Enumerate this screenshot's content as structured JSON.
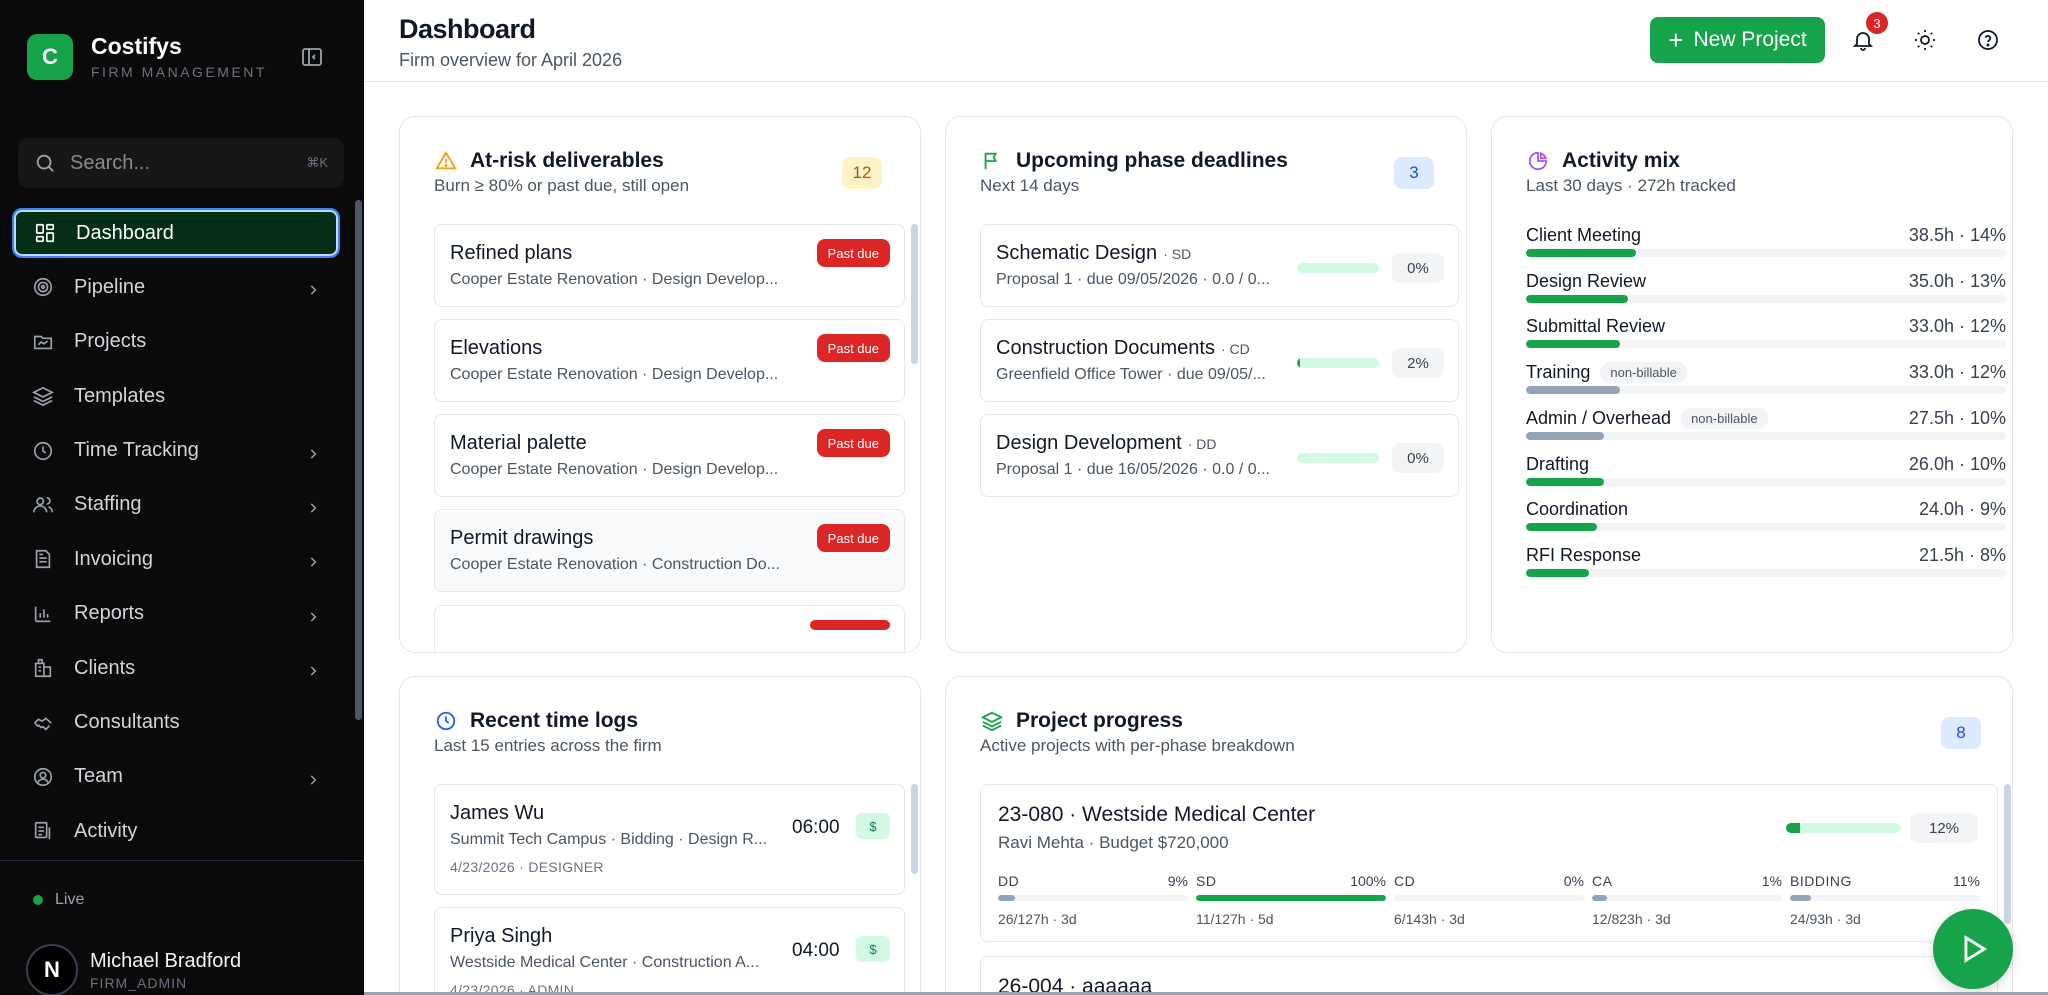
{
  "brand": {
    "initial": "C",
    "name": "Costifys",
    "subtitle": "FIRM MANAGEMENT"
  },
  "search": {
    "placeholder": "Search...",
    "shortcut": "⌘K"
  },
  "nav": [
    {
      "label": "Dashboard",
      "icon": "dashboard-icon",
      "active": true,
      "chevron": false
    },
    {
      "label": "Pipeline",
      "icon": "target-icon",
      "chevron": true
    },
    {
      "label": "Projects",
      "icon": "folder-icon",
      "chevron": false
    },
    {
      "label": "Templates",
      "icon": "layers-icon",
      "chevron": false
    },
    {
      "label": "Time Tracking",
      "icon": "clock-icon",
      "chevron": true
    },
    {
      "label": "Staffing",
      "icon": "users-icon",
      "chevron": true
    },
    {
      "label": "Invoicing",
      "icon": "invoice-icon",
      "chevron": true
    },
    {
      "label": "Reports",
      "icon": "bar-chart-icon",
      "chevron": true
    },
    {
      "label": "Clients",
      "icon": "building-icon",
      "chevron": true
    },
    {
      "label": "Consultants",
      "icon": "handshake-icon",
      "chevron": false
    },
    {
      "label": "Team",
      "icon": "user-circle-icon",
      "chevron": true
    },
    {
      "label": "Activity",
      "icon": "activity-icon",
      "chevron": false
    }
  ],
  "status": {
    "live_label": "Live"
  },
  "user": {
    "initial": "N",
    "name": "Michael Bradford",
    "role": "FIRM_ADMIN"
  },
  "header": {
    "title": "Dashboard",
    "subtitle": "Firm overview for April 2026",
    "new_project_label": "New Project",
    "notification_count": "3"
  },
  "at_risk": {
    "title": "At-risk deliverables",
    "subtitle": "Burn ≥ 80% or past due, still open",
    "count": "12",
    "items": [
      {
        "title": "Refined plans",
        "sub": "Cooper Estate Renovation · Design Develop...",
        "badge": "Past due"
      },
      {
        "title": "Elevations",
        "sub": "Cooper Estate Renovation · Design Develop...",
        "badge": "Past due"
      },
      {
        "title": "Material palette",
        "sub": "Cooper Estate Renovation · Design Develop...",
        "badge": "Past due"
      },
      {
        "title": "Permit drawings",
        "sub": "Cooper Estate Renovation · Construction Do...",
        "badge": "Past due"
      }
    ]
  },
  "deadlines": {
    "title": "Upcoming phase deadlines",
    "subtitle": "Next 14 days",
    "count": "3",
    "items": [
      {
        "title": "Schematic Design",
        "tag": "· SD",
        "sub": "Proposal 1 · due 09/05/2026 · 0.0 / 0...",
        "pct": "0%",
        "progress": 0
      },
      {
        "title": "Construction Documents",
        "tag": "· CD",
        "sub": "Greenfield Office Tower · due 09/05/...",
        "pct": "2%",
        "progress": 2
      },
      {
        "title": "Design Development",
        "tag": "· DD",
        "sub": "Proposal 1 · due 16/05/2026 · 0.0 / 0...",
        "pct": "0%",
        "progress": 0
      }
    ]
  },
  "activity_mix": {
    "title": "Activity mix",
    "subtitle": "Last 30 days · 272h tracked",
    "items": [
      {
        "name": "Client Meeting",
        "value": "38.5h · 14%",
        "pct": 14,
        "billable": true
      },
      {
        "name": "Design Review",
        "value": "35.0h · 13%",
        "pct": 13,
        "billable": true
      },
      {
        "name": "Submittal Review",
        "value": "33.0h · 12%",
        "pct": 12,
        "billable": true
      },
      {
        "name": "Training",
        "value": "33.0h · 12%",
        "pct": 12,
        "billable": false,
        "tag": "non-billable"
      },
      {
        "name": "Admin / Overhead",
        "value": "27.5h · 10%",
        "pct": 10,
        "billable": false,
        "tag": "non-billable"
      },
      {
        "name": "Drafting",
        "value": "26.0h · 10%",
        "pct": 10,
        "billable": true
      },
      {
        "name": "Coordination",
        "value": "24.0h · 9%",
        "pct": 9,
        "billable": true
      },
      {
        "name": "RFI Response",
        "value": "21.5h · 8%",
        "pct": 8,
        "billable": true
      }
    ],
    "colors": {
      "billable": "#16a34a",
      "non_billable": "#94a3b8"
    }
  },
  "time_logs": {
    "title": "Recent time logs",
    "subtitle": "Last 15 entries across the firm",
    "items": [
      {
        "name": "James Wu",
        "sub": "Summit Tech Campus · Bidding · Design R...",
        "meta": "4/23/2026 · DESIGNER",
        "time": "06:00",
        "money": "$"
      },
      {
        "name": "Priya Singh",
        "sub": "Westside Medical Center · Construction A...",
        "meta": "4/23/2026 · ADMIN",
        "time": "04:00",
        "money": "$"
      }
    ]
  },
  "project_progress": {
    "title": "Project progress",
    "subtitle": "Active projects with per-phase breakdown",
    "count": "8",
    "projects": [
      {
        "title": "23-080 · Westside Medical Center",
        "sub": "Ravi Mehta · Budget $720,000",
        "pct": "12%",
        "progress": 12,
        "phases": [
          {
            "name": "DD",
            "pct": "9%",
            "progress": 9,
            "meta": "26/127h · 3d",
            "color": "#94a3b8"
          },
          {
            "name": "SD",
            "pct": "100%",
            "progress": 100,
            "meta": "11/127h · 5d",
            "color": "#16a34a"
          },
          {
            "name": "CD",
            "pct": "0%",
            "progress": 0,
            "meta": "6/143h · 3d",
            "color": "#94a3b8"
          },
          {
            "name": "CA",
            "pct": "1%",
            "progress": 1,
            "meta": "12/823h · 3d",
            "color": "#94a3b8"
          },
          {
            "name": "BIDDING",
            "pct": "11%",
            "progress": 11,
            "meta": "24/93h · 3d",
            "color": "#94a3b8"
          }
        ]
      },
      {
        "title": "26-004 · aaaaaa"
      }
    ]
  }
}
